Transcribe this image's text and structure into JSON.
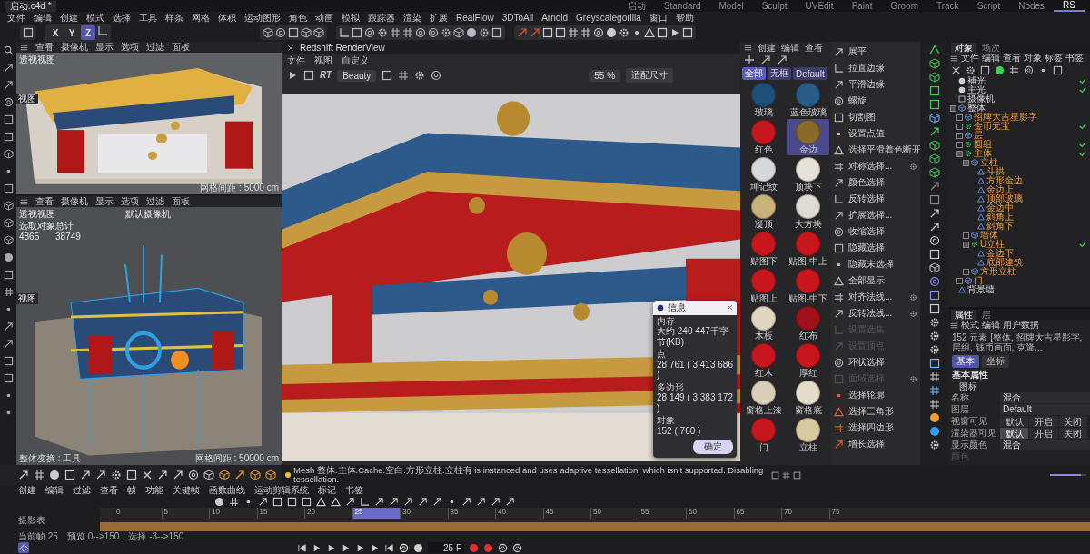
{
  "title_bar": {
    "file_tab": "启动.c4d *",
    "layouts": [
      {
        "label": "启动",
        "selected": false
      },
      {
        "label": "Standard",
        "selected": false
      },
      {
        "label": "Model",
        "selected": false
      },
      {
        "label": "Sculpt",
        "selected": false
      },
      {
        "label": "UVEdit",
        "selected": false
      },
      {
        "label": "Paint",
        "selected": false
      },
      {
        "label": "Groom",
        "selected": false
      },
      {
        "label": "Track",
        "selected": false
      },
      {
        "label": "Script",
        "selected": false
      },
      {
        "label": "Nodes",
        "selected": false
      },
      {
        "label": "RS",
        "selected": true
      }
    ]
  },
  "menu_bar": [
    "文件",
    "编辑",
    "创建",
    "模式",
    "选择",
    "工具",
    "样条",
    "网格",
    "体积",
    "运动图形",
    "角色",
    "动画",
    "模拟",
    "跟踪器",
    "渲染",
    "扩展",
    "RealFlow",
    "3DToAll",
    "Arnold",
    "Greyscalegorilla",
    "窗口",
    "帮助"
  ],
  "axis_buttons": [
    "X",
    "Y",
    "Z"
  ],
  "viewports": [
    {
      "menu": [
        "查看",
        "摄像机",
        "显示",
        "选项",
        "过滤",
        "面板"
      ],
      "view_title": "透视视图",
      "side_label": "视图",
      "footer_right": "网格间距 : 5000 cm",
      "kind": "shaded"
    },
    {
      "menu": [
        "查看",
        "摄像机",
        "显示",
        "选项",
        "过滤",
        "面板"
      ],
      "view_title": "透视视图",
      "side_label": "视图",
      "camera": "默认摄像机",
      "stats": [
        [
          "选取对象",
          "总计"
        ],
        [
          "4865",
          "38749"
        ]
      ],
      "footer_left": "整体变换 : 工具",
      "footer_right": "网格间距 : 50000 cm",
      "kind": "wireframe"
    }
  ],
  "render_view": {
    "title": "Redshift RenderView",
    "menu": [
      "文件",
      "视图",
      "自定义"
    ],
    "rt": "RT",
    "preset": "Beauty",
    "zoom": "55 %",
    "fit": "适配尺寸"
  },
  "info_dialog": {
    "title": "信息",
    "rows": [
      {
        "label": "内存",
        "value": "大约 240 447千字节(KB)"
      },
      {
        "label": "点",
        "value": "28 761 ( 3 413 686 )"
      },
      {
        "label": "多边形",
        "value": "28 149 ( 3 383 172 )"
      },
      {
        "label": "对象",
        "value": "152 ( 760 )"
      }
    ],
    "ok": "确定"
  },
  "materials": {
    "menu": [
      "创建",
      "编辑",
      "查看"
    ],
    "filters": [
      {
        "label": "全部",
        "selected": true
      },
      {
        "label": "无框",
        "selected": false
      },
      {
        "label": "Default",
        "selected": false
      }
    ],
    "items": [
      {
        "name": "玻璃",
        "color": "#1d4f78",
        "selected": false
      },
      {
        "name": "蓝色玻璃",
        "color": "#2a5c8a",
        "selected": false
      },
      {
        "name": "红色",
        "color": "#c8161d",
        "selected": false
      },
      {
        "name": "金边",
        "color": "#8a6a2a",
        "selected": true
      },
      {
        "name": "坤记纹",
        "color": "#d6d8dc",
        "selected": false
      },
      {
        "name": "顶块下",
        "color": "#e6e2d8",
        "selected": false
      },
      {
        "name": "凝顶",
        "color": "#c9b27a",
        "selected": false
      },
      {
        "name": "大方块",
        "color": "#dedbd3",
        "selected": false
      },
      {
        "name": "贴图下",
        "color": "#c8161d",
        "selected": false
      },
      {
        "name": "贴图-中上",
        "color": "#c8161d",
        "selected": false
      },
      {
        "name": "贴图上",
        "color": "#c8161d",
        "selected": false
      },
      {
        "name": "贴图-中下",
        "color": "#c8161d",
        "selected": false
      },
      {
        "name": "木板",
        "color": "#e0d6c0",
        "selected": false
      },
      {
        "name": "红布",
        "color": "#a0101a",
        "selected": false
      },
      {
        "name": "红木",
        "color": "#c8161d",
        "selected": false
      },
      {
        "name": "厚红",
        "color": "#c8161d",
        "selected": false
      },
      {
        "name": "窗格上漆",
        "color": "#d8cfb8",
        "selected": false
      },
      {
        "name": "窗格底",
        "color": "#e2dcc8",
        "selected": false
      },
      {
        "name": "门",
        "color": "#c8161d",
        "selected": false
      },
      {
        "name": "立柱",
        "color": "#d9c9a0",
        "selected": false
      }
    ]
  },
  "commands": [
    {
      "label": "展平",
      "disabled": false,
      "options": false
    },
    {
      "label": "拉直边缘",
      "disabled": false,
      "options": false
    },
    {
      "label": "平滑边缘",
      "disabled": false,
      "options": false
    },
    {
      "label": "螺旋",
      "disabled": false,
      "options": false
    },
    {
      "label": "切割图",
      "disabled": false,
      "options": false
    },
    {
      "label": "设置点值",
      "disabled": false,
      "options": false
    },
    {
      "label": "选择平滑着色断开",
      "disabled": false,
      "options": false
    },
    {
      "label": "对称选择...",
      "disabled": false,
      "options": true
    },
    {
      "label": "颜色选择",
      "disabled": false,
      "options": false
    },
    {
      "label": "反转选择",
      "disabled": false,
      "options": false
    },
    {
      "label": "扩展选择...",
      "disabled": false,
      "options": false
    },
    {
      "label": "收缩选择",
      "disabled": false,
      "options": false
    },
    {
      "label": "隐藏选择",
      "disabled": false,
      "options": false
    },
    {
      "label": "隐藏未选择",
      "disabled": false,
      "options": false
    },
    {
      "label": "全部显示",
      "disabled": false,
      "options": false
    },
    {
      "label": "对齐法线...",
      "disabled": false,
      "options": true
    },
    {
      "label": "反转法线...",
      "disabled": false,
      "options": true
    },
    {
      "label": "设置选集",
      "disabled": true,
      "options": false
    },
    {
      "label": "设置顶点",
      "disabled": true,
      "options": false
    },
    {
      "label": "环状选择",
      "disabled": false,
      "options": false
    },
    {
      "label": "面域选择",
      "disabled": true,
      "options": true
    },
    {
      "label": "选择轮廓",
      "disabled": false,
      "options": false
    },
    {
      "label": "选择三角形",
      "disabled": false,
      "options": false
    },
    {
      "label": "选择四边形",
      "disabled": false,
      "options": false
    },
    {
      "label": "增长选择",
      "disabled": false,
      "options": false
    }
  ],
  "objects": {
    "tabs": [
      {
        "label": "对象",
        "selected": true
      },
      {
        "label": "场次",
        "selected": false
      }
    ],
    "menu": [
      "文件",
      "编辑",
      "查看",
      "对象",
      "标签",
      "书签"
    ],
    "tree": [
      {
        "name": "補光",
        "enabled": true,
        "kind": "light"
      },
      {
        "name": "主光",
        "enabled": true,
        "kind": "light"
      },
      {
        "name": "摄像机",
        "enabled": false,
        "kind": "camera"
      },
      {
        "name": "整体",
        "enabled": false,
        "kind": "group",
        "expanded": true,
        "children": [
          {
            "name": "招牌大吉星影字",
            "enabled": false,
            "kind": "group",
            "expanded": false
          },
          {
            "name": "金币元宝",
            "enabled": true,
            "kind": "cloner",
            "expanded": false
          },
          {
            "name": "层",
            "enabled": false,
            "kind": "group",
            "expanded": false
          },
          {
            "name": "圆组",
            "enabled": true,
            "kind": "cloner",
            "expanded": false
          },
          {
            "name": "主体",
            "enabled": true,
            "kind": "cloner",
            "expanded": true,
            "children": [
              {
                "name": "立柱",
                "enabled": false,
                "kind": "group",
                "expanded": true,
                "children": [
                  {
                    "name": "斗拱",
                    "enabled": false,
                    "kind": "mesh"
                  },
                  {
                    "name": "方形金边",
                    "enabled": false,
                    "kind": "mesh"
                  },
                  {
                    "name": "金边上",
                    "enabled": false,
                    "kind": "mesh"
                  },
                  {
                    "name": "顶部玻璃",
                    "enabled": false,
                    "kind": "mesh"
                  },
                  {
                    "name": "金边中",
                    "enabled": false,
                    "kind": "mesh"
                  },
                  {
                    "name": "斜角上",
                    "enabled": false,
                    "kind": "mesh"
                  },
                  {
                    "name": "斜角下",
                    "enabled": false,
                    "kind": "mesh"
                  }
                ]
              },
              {
                "name": "墙体",
                "enabled": false,
                "kind": "group",
                "expanded": false
              },
              {
                "name": "U立柱",
                "enabled": true,
                "kind": "cloner",
                "expanded": true,
                "children": [
                  {
                    "name": "金边下",
                    "enabled": false,
                    "kind": "mesh"
                  },
                  {
                    "name": "底部建筑",
                    "enabled": false,
                    "kind": "mesh"
                  }
                ]
              },
              {
                "name": "方形立柱",
                "enabled": false,
                "kind": "group",
                "expanded": false
              }
            ]
          },
          {
            "name": "门",
            "enabled": false,
            "kind": "group",
            "expanded": false
          }
        ]
      },
      {
        "name": "背景墙",
        "enabled": false,
        "kind": "mesh"
      }
    ]
  },
  "attributes": {
    "tabs": [
      {
        "label": "属性",
        "selected": true
      },
      {
        "label": "层",
        "selected": false
      }
    ],
    "menu": [
      "模式",
      "编辑",
      "用户数据"
    ],
    "summary": "152 元素 [整体, 招牌大吉星影字, 层组, 钱币画面, 克隆...",
    "sub_tabs": [
      {
        "label": "基本",
        "selected": true
      },
      {
        "label": "坐标",
        "selected": false
      }
    ],
    "section": "基本属性",
    "group": "图标",
    "fields": [
      {
        "label": "名称",
        "kind": "text",
        "value": "混合"
      },
      {
        "label": "图层",
        "kind": "text",
        "value": "Default"
      },
      {
        "label": "视窗可见",
        "kind": "choice",
        "options": [
          {
            "label": "默认",
            "selected": false
          },
          {
            "label": "开启",
            "selected": false
          },
          {
            "label": "关闭",
            "selected": false
          }
        ]
      },
      {
        "label": "渲染器可见",
        "kind": "choice",
        "options": [
          {
            "label": "默认",
            "selected": true
          },
          {
            "label": "开启",
            "selected": false
          },
          {
            "label": "关闭",
            "selected": false
          }
        ]
      },
      {
        "label": "显示颜色",
        "kind": "text",
        "value": "混合"
      },
      {
        "label": "颜色",
        "kind": "disabled"
      }
    ]
  },
  "thumbnail_size": {
    "level": 0.85
  },
  "status_message": "Mesh 整体.主体.Cache.空白.方形立柱.立柱有 is instanced and uses adaptive tessellation, which isn't supported. Disabling tessellation. —",
  "timeline": {
    "menu": [
      "创建",
      "编辑",
      "过滤",
      "查看",
      "帧",
      "功能",
      "关键帧",
      "函数曲线",
      "运动剪辑系统",
      "标记",
      "书签"
    ],
    "track_label": "摄影表",
    "ticks": [
      {
        "label": "0",
        "selected": false
      },
      {
        "label": "5",
        "selected": false
      },
      {
        "label": "10",
        "selected": false
      },
      {
        "label": "15",
        "selected": false
      },
      {
        "label": "20",
        "selected": false
      },
      {
        "label": "25",
        "selected": true
      },
      {
        "label": "30",
        "selected": false
      },
      {
        "label": "35",
        "selected": false
      },
      {
        "label": "40",
        "selected": false
      },
      {
        "label": "45",
        "selected": false
      },
      {
        "label": "50",
        "selected": false
      },
      {
        "label": "55",
        "selected": false
      },
      {
        "label": "60",
        "selected": false
      },
      {
        "label": "65",
        "selected": false
      },
      {
        "label": "70",
        "selected": false
      },
      {
        "label": "75",
        "selected": false
      }
    ],
    "footer": [
      "当前帧 25",
      "预览 0-->150",
      "选择 -3-->150"
    ],
    "frame_field": "25 F"
  }
}
